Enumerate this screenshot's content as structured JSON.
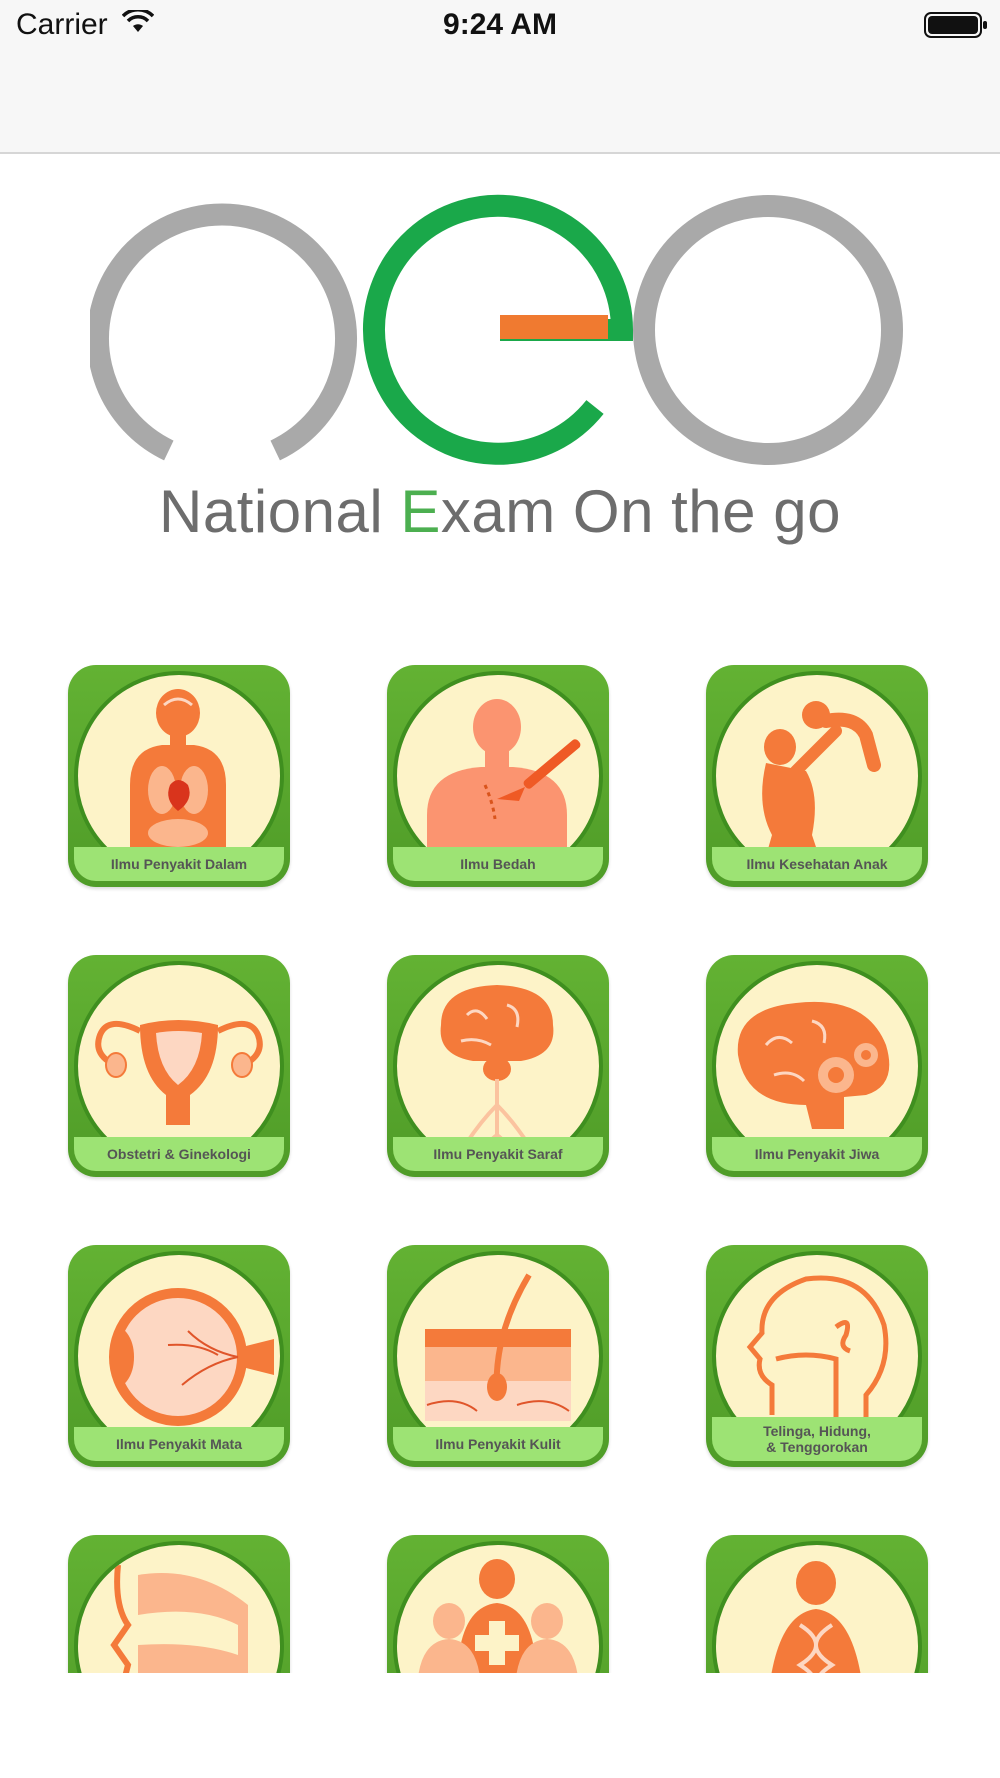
{
  "status_bar": {
    "carrier": "Carrier",
    "time": "9:24 AM"
  },
  "logo": {
    "tagline_pre": "National ",
    "tagline_e": "E",
    "tagline_post": "xam On the go"
  },
  "categories": [
    {
      "label": "Ilmu Penyakit Dalam",
      "icon": "anatomy-organs-icon"
    },
    {
      "label": "Ilmu Bedah",
      "icon": "surgery-scalpel-icon"
    },
    {
      "label": "Ilmu Kesehatan Anak",
      "icon": "mother-child-icon"
    },
    {
      "label": "Obstetri & Ginekologi",
      "icon": "uterus-icon"
    },
    {
      "label": "Ilmu Penyakit Saraf",
      "icon": "brain-nerves-icon"
    },
    {
      "label": "Ilmu Penyakit Jiwa",
      "icon": "brain-gears-icon"
    },
    {
      "label": "Ilmu Penyakit Mata",
      "icon": "eye-icon"
    },
    {
      "label": "Ilmu Penyakit Kulit",
      "icon": "skin-layers-icon"
    },
    {
      "label_line1": "Telinga, Hidung,",
      "label_line2": "& Tenggorokan",
      "icon": "head-throat-icon"
    },
    {
      "label": "",
      "icon": "oral-cavity-icon"
    },
    {
      "label": "",
      "icon": "public-health-icon"
    },
    {
      "label": "",
      "icon": "genetics-icon"
    }
  ],
  "colors": {
    "tile_green": "#5aac2e",
    "circle_fill": "#fdf3c8",
    "label_band": "#9de374",
    "icon_orange": "#f47a3a",
    "logo_green": "#1aa84a",
    "logo_gray": "#a9a9a9",
    "logo_orange": "#f07a30"
  }
}
